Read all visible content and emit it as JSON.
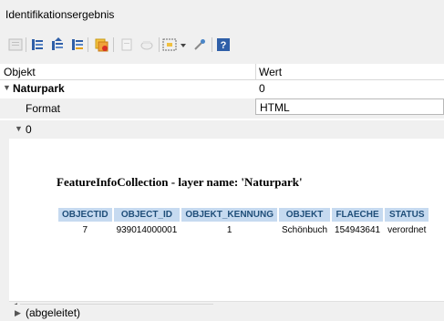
{
  "panel": {
    "title": "Identifikationsergebnis"
  },
  "toolbar": {
    "buttons": [
      {
        "name": "expand-tree-icon"
      },
      {
        "name": "collapse-tree-icon"
      },
      {
        "name": "expand-new-results-icon"
      },
      {
        "name": "highlight-features-icon"
      },
      {
        "name": "copy-feature-icon"
      },
      {
        "name": "print-icon"
      },
      {
        "name": "open-form-icon"
      },
      {
        "name": "select-dropdown-icon"
      },
      {
        "name": "identify-tool-icon"
      },
      {
        "name": "help-icon"
      }
    ]
  },
  "tree": {
    "header": {
      "col1": "Objekt",
      "col2": "Wert"
    },
    "layer": {
      "label": "Naturpark",
      "value": "0"
    },
    "format": {
      "label": "Format",
      "value": "HTML"
    },
    "feature": {
      "label": "0"
    },
    "html": {
      "heading": "FeatureInfoCollection - layer name: 'Naturpark'",
      "columns": [
        "OBJECTID",
        "OBJECT_ID",
        "OBJEKT_KENNUNG",
        "OBJEKT",
        "FLAECHE",
        "STATUS"
      ],
      "rows": [
        [
          "7",
          "939014000001",
          "1",
          "Schönbuch",
          "154943641",
          "verordnet"
        ]
      ]
    },
    "derived": {
      "label": "(abgeleitet)"
    }
  },
  "colors": {
    "header_bg": "#c6daf0",
    "header_text": "#1f4e79"
  }
}
